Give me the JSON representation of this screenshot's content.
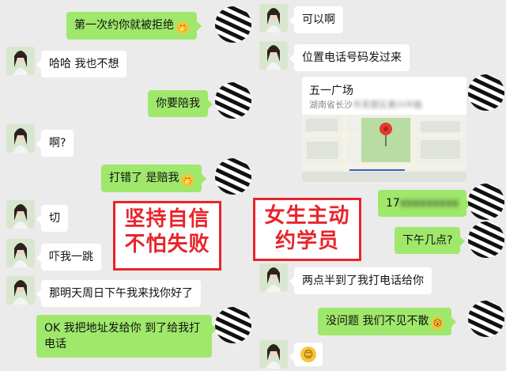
{
  "left_chat": {
    "messages": [
      {
        "dir": "out",
        "text": "第一次约你就被拒绝",
        "emoji": "mouth-hand-emoji"
      },
      {
        "dir": "in",
        "text": "哈哈 我也不想"
      },
      {
        "dir": "out",
        "text": "你要陪我"
      },
      {
        "dir": "in",
        "text": "啊?"
      },
      {
        "dir": "out",
        "text": "打错了 是赔我",
        "emoji": "mouth-hand-emoji"
      },
      {
        "dir": "in",
        "text": "切"
      },
      {
        "dir": "in",
        "text": "吓我一跳"
      },
      {
        "dir": "in",
        "text": "那明天周日下午我来找你好了"
      },
      {
        "dir": "out",
        "text": "OK 我把地址发给你 到了给我打电话"
      }
    ],
    "overlay_line1": "坚持自信",
    "overlay_line2": "不怕失败"
  },
  "right_chat": {
    "messages": [
      {
        "dir": "in",
        "text": "可以啊"
      },
      {
        "dir": "in",
        "text": "位置电话号码发过来"
      },
      {
        "dir": "out",
        "type": "location",
        "title": "五一广场",
        "address_visible": "湖南省长沙",
        "address_blurred": "市芙蓉区黄兴中路"
      },
      {
        "dir": "out",
        "text": "17",
        "blurred_suffix": "xxxxxxxxx"
      },
      {
        "dir": "out",
        "text": "下午几点?"
      },
      {
        "dir": "in",
        "text": "两点半到了我打电话给你"
      },
      {
        "dir": "out",
        "text": "没问题 我们不见不散",
        "emoji": "surprised-emoji"
      },
      {
        "dir": "in",
        "type": "emoji",
        "emoji": "smile-emoji"
      }
    ],
    "overlay_line1": "女生主动",
    "overlay_line2": "约学员"
  },
  "colors": {
    "background": "#ebebeb",
    "out_bubble": "#9fe86b",
    "in_bubble": "#ffffff",
    "overlay_red": "#e8242b"
  }
}
